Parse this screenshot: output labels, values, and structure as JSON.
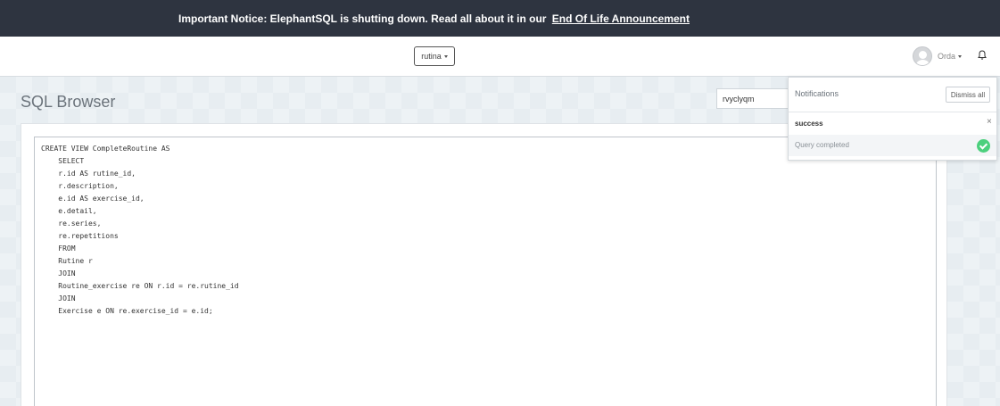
{
  "notice": {
    "text": "Important Notice: ElephantSQL is shutting down. Read all about it in our",
    "link_text": "End Of Life Announcement"
  },
  "topnav": {
    "database_select": "rutina",
    "user_name": "Orda",
    "icons": [
      "avatar",
      "caret-down-icon",
      "bell-icon"
    ]
  },
  "page": {
    "title": "SQL Browser",
    "search_value": "rvyclyqm"
  },
  "editor": {
    "code": "CREATE VIEW CompleteRoutine AS\n    SELECT\n    r.id AS rutine_id,\n    r.description,\n    e.id AS exercise_id,\n    e.detail,\n    re.series,\n    re.repetitions\n    FROM\n    Rutine r\n    JOIN\n    Routine_exercise re ON r.id = re.rutine_id\n    JOIN\n    Exercise e ON re.exercise_id = e.id;"
  },
  "notifications": {
    "title": "Notifications",
    "dismiss_label": "Dismiss all",
    "items": [
      {
        "type": "success",
        "message": "Query completed",
        "close": "×"
      }
    ]
  },
  "colors": {
    "notice_bg": "#2e3440",
    "success": "#4cd07d",
    "page_bg": "#e7edf1"
  }
}
